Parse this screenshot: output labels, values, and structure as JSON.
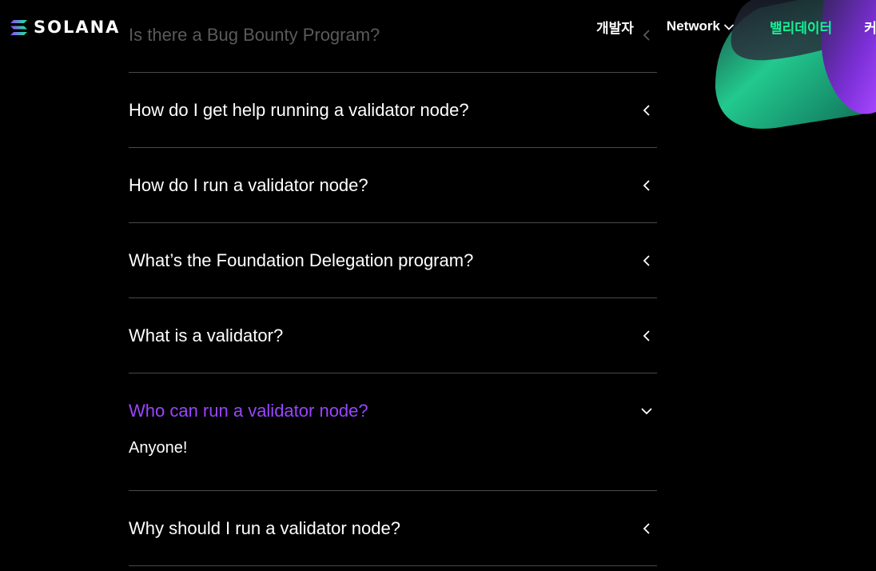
{
  "header": {
    "logo_text": "SOLANA",
    "nav": {
      "developers": "개발자",
      "network": "Network",
      "validators": "밸리데이터",
      "more": "커"
    }
  },
  "faq": {
    "items": [
      {
        "question": "Is there a Bug Bounty Program?",
        "state": "collapsed"
      },
      {
        "question": "How do I get help running a validator node?",
        "state": "collapsed"
      },
      {
        "question": "How do I run a validator node?",
        "state": "collapsed"
      },
      {
        "question": "What’s the Foundation Delegation program?",
        "state": "collapsed"
      },
      {
        "question": "What is a validator?",
        "state": "collapsed"
      },
      {
        "question": "Who can run a validator node?",
        "state": "expanded",
        "answer": "Anyone!"
      },
      {
        "question": "Why should I run a validator node?",
        "state": "collapsed"
      }
    ]
  },
  "colors": {
    "background": "#000000",
    "accent_green": "#14f195",
    "accent_purple": "#9945ff",
    "divider": "#4a4a4a"
  }
}
